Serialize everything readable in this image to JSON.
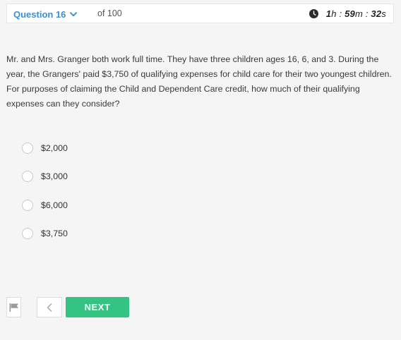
{
  "header": {
    "question_label": "Question 16",
    "of_total": "of 100",
    "timer": {
      "hours": "1",
      "h_unit": "h",
      "minutes": "59",
      "m_unit": "m",
      "seconds": "32",
      "s_unit": "s",
      "separator": ":"
    }
  },
  "question": {
    "text": "Mr. and Mrs. Granger both work full time. They have three children ages 16, 6, and 3. During the year, the Grangers' paid $3,750 of qualifying expenses for child care for their two youngest children. For purposes of claiming the Child and Dependent Care credit, how much of their qualifying expenses can they consider?"
  },
  "options": [
    {
      "label": "$2,000"
    },
    {
      "label": "$3,000"
    },
    {
      "label": "$6,000"
    },
    {
      "label": "$3,750"
    }
  ],
  "footer": {
    "next_label": "NEXT",
    "back_glyph": "<"
  },
  "icons": {
    "chevron": "chevron-down-icon",
    "clock": "clock-icon",
    "flag": "flag-icon",
    "back": "chevron-left-icon"
  },
  "colors": {
    "accent_blue": "#3d8fd4",
    "next_green": "#34c383"
  }
}
